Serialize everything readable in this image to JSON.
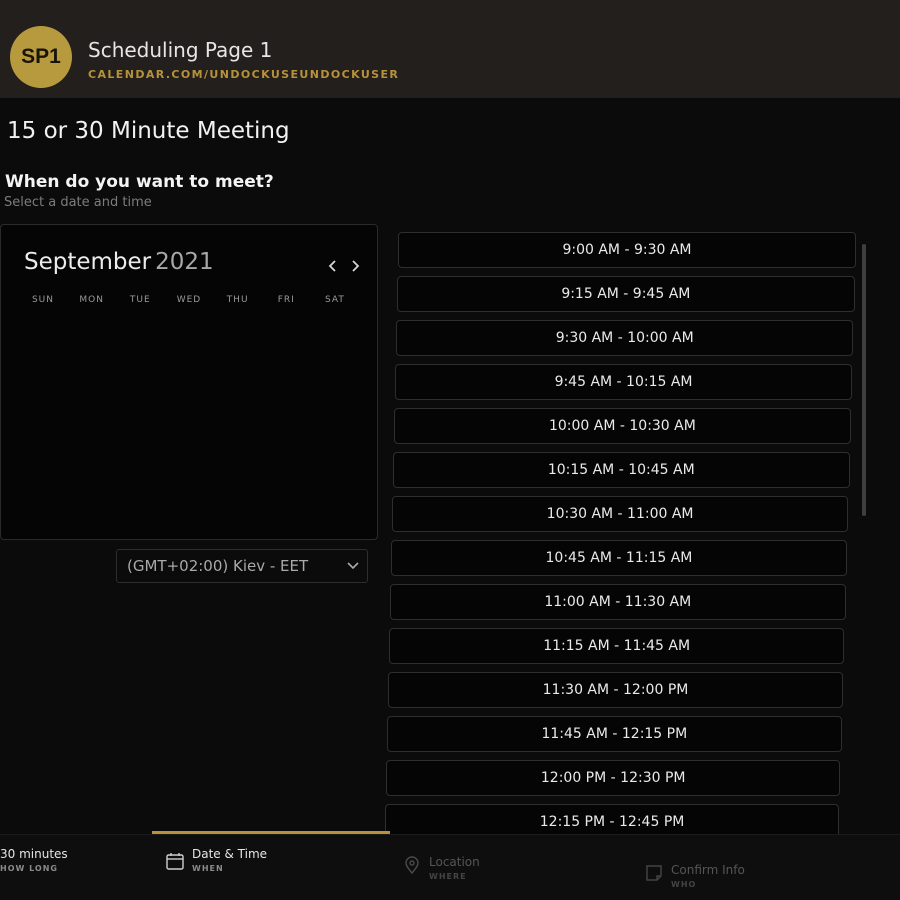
{
  "header": {
    "avatar_initials": "SP1",
    "title": "Scheduling Page 1",
    "url": "CALENDAR.COM/UNDOCKUSEUNDOCKUSER"
  },
  "page": {
    "title": "15 or 30 Minute Meeting",
    "question": "When do you want to meet?",
    "subtitle": "Select a date and time"
  },
  "calendar": {
    "month": "September",
    "year": "2021",
    "weekdays": [
      "SUN",
      "MON",
      "TUE",
      "WED",
      "THU",
      "FRI",
      "SAT"
    ]
  },
  "timezone": {
    "value": "(GMT+02:00) Kiev - EET"
  },
  "slots": [
    "9:00 AM - 9:30 AM",
    "9:15 AM - 9:45 AM",
    "9:30 AM - 10:00 AM",
    "9:45 AM - 10:15 AM",
    "10:00 AM - 10:30 AM",
    "10:15 AM - 10:45 AM",
    "10:30 AM - 11:00 AM",
    "10:45 AM - 11:15 AM",
    "11:00 AM - 11:30 AM",
    "11:15 AM - 11:45 AM",
    "11:30 AM - 12:00 PM",
    "11:45 AM - 12:15 PM",
    "12:00 PM - 12:30 PM",
    "12:15 PM - 12:45 PM"
  ],
  "steps": [
    {
      "title": "30 minutes",
      "sub": "HOW LONG",
      "icon": "clock-icon"
    },
    {
      "title": "Date & Time",
      "sub": "WHEN",
      "icon": "calendar-icon"
    },
    {
      "title": "Location",
      "sub": "WHERE",
      "icon": "location-pin-icon"
    },
    {
      "title": "Confirm Info",
      "sub": "WHO",
      "icon": "note-icon"
    }
  ],
  "colors": {
    "accent": "#b8923a",
    "avatar": "#b89a3e",
    "header_bg": "#221f1c",
    "page_bg": "#0b0b0b"
  }
}
